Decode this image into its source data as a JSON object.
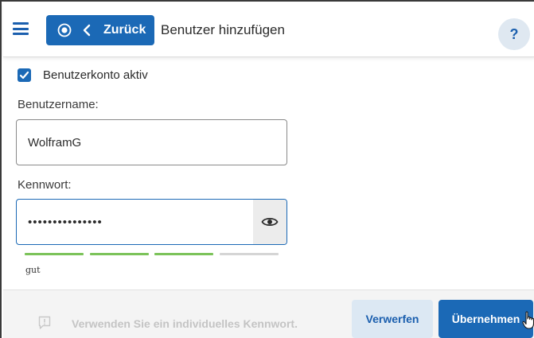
{
  "header": {
    "back_label": "Zurück",
    "title": "Benutzer hinzufügen",
    "help_label": "?"
  },
  "form": {
    "account_active": {
      "label": "Benutzerkonto aktiv",
      "checked": true
    },
    "username": {
      "label": "Benutzername:",
      "value": "WolframG"
    },
    "password": {
      "label": "Kennwort:",
      "value": "•••••••••••••••"
    },
    "strength": {
      "label": "gut",
      "level": 3,
      "segments": 4,
      "filled_color": "#7cc35a",
      "empty_color": "#d5d5d5"
    }
  },
  "footer": {
    "hint": "Verwenden Sie ein individuelles Kennwort.",
    "discard_label": "Verwerfen",
    "apply_label": "Übernehmen"
  },
  "colors": {
    "accent": "#1b69b6",
    "accent_light": "#dce8f3"
  },
  "icons": {
    "menu": "menu-icon",
    "back_target": "target-icon",
    "back_chevron": "chevron-left-icon",
    "eye": "eye-icon",
    "hint": "info-icon",
    "pointer": "hand-pointer-icon"
  }
}
